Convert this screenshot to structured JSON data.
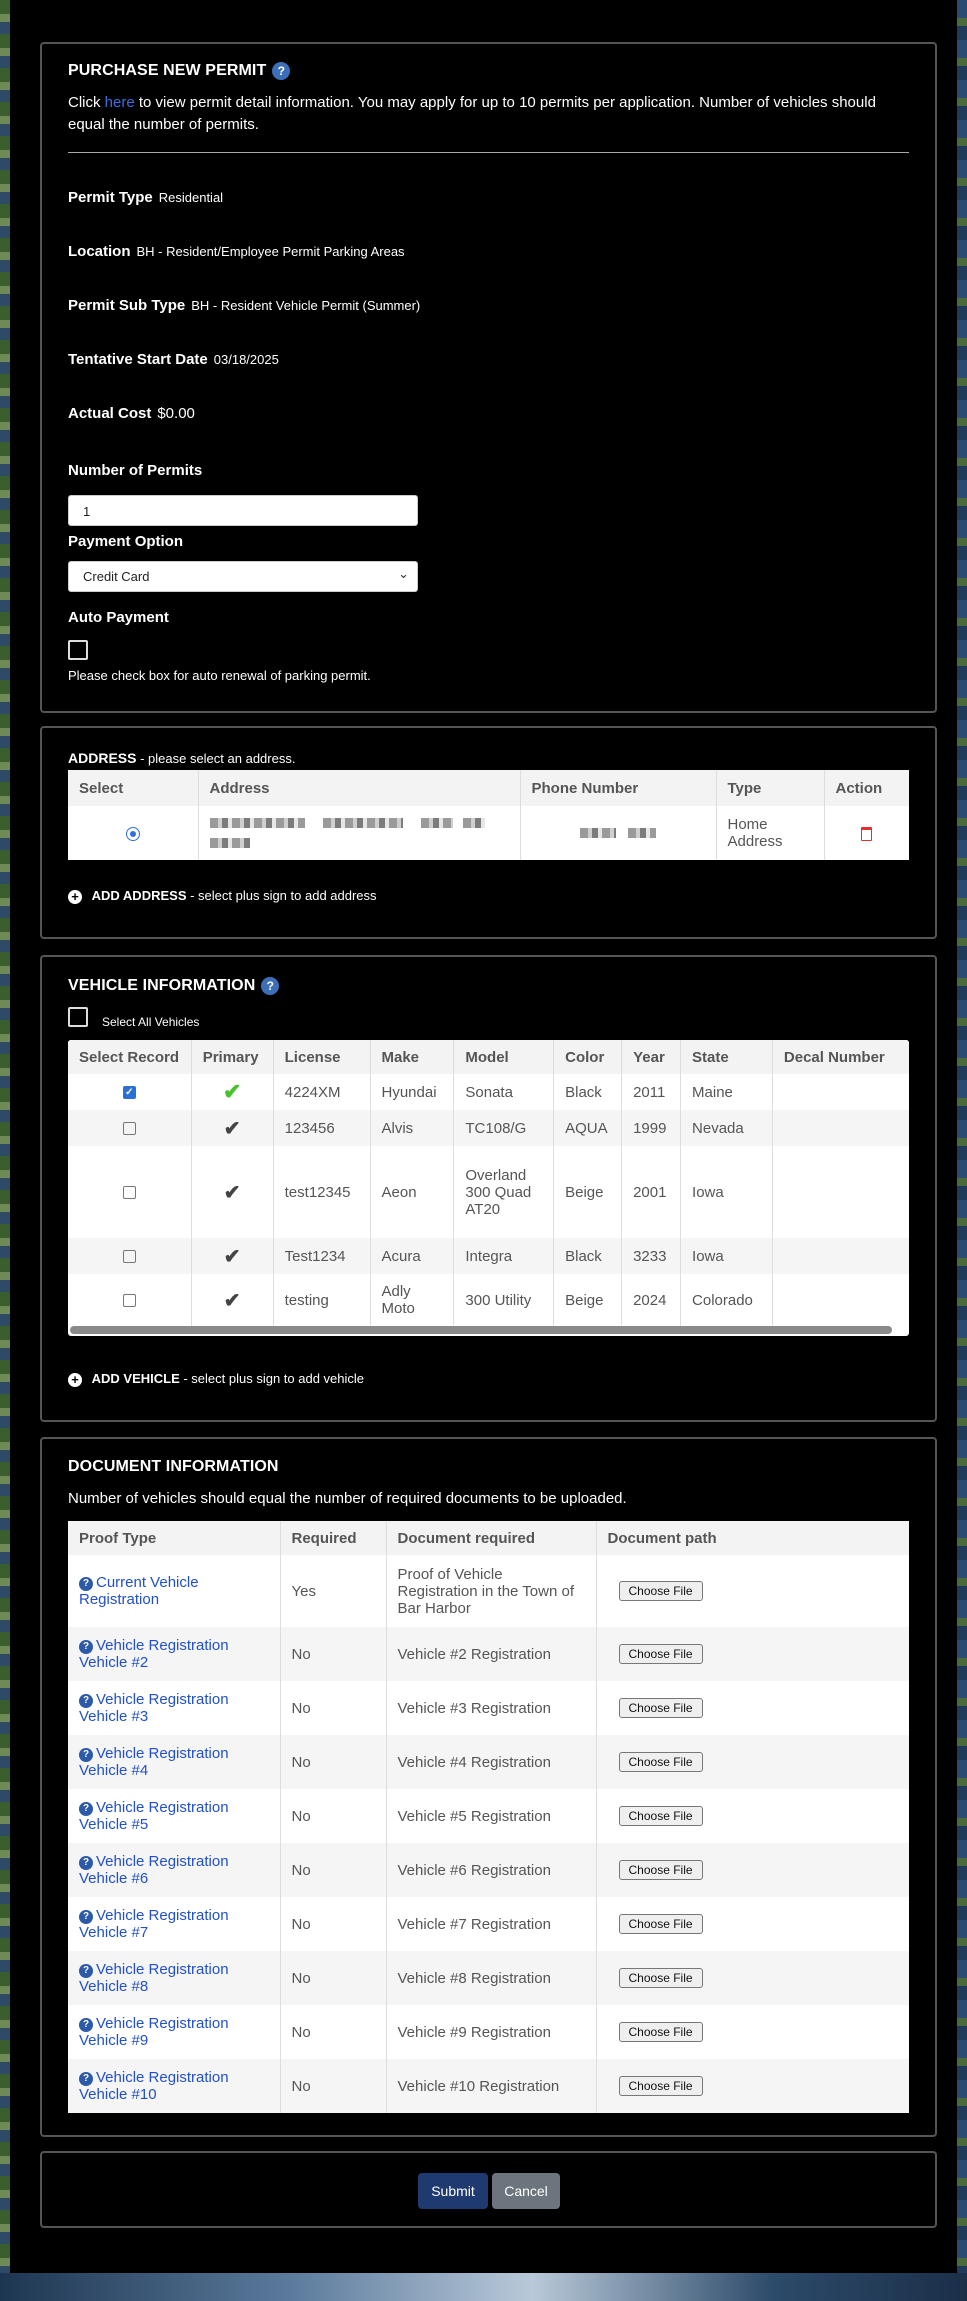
{
  "purchase": {
    "title": "PURCHASE NEW PERMIT",
    "help": "?",
    "intro_pre": "Click ",
    "intro_link": "here",
    "intro_post": " to view permit detail information. You may apply for up to 10 permits per application. Number of vehicles should equal the number of permits.",
    "fields": [
      {
        "label": "Permit Type",
        "value": "Residential"
      },
      {
        "label": "Location",
        "value": "BH - Resident/Employee Permit Parking Areas"
      },
      {
        "label": "Permit Sub Type",
        "value": "BH - Resident Vehicle Permit (Summer)"
      },
      {
        "label": "Tentative Start Date",
        "value": "03/18/2025"
      },
      {
        "label": "Actual Cost",
        "value": "$0.00"
      }
    ],
    "num_permits_label": "Number of Permits",
    "num_permits_value": "1",
    "payment_label": "Payment Option",
    "payment_value": "Credit Card",
    "auto_label": "Auto Payment",
    "auto_note": "Please check box for auto renewal of parking permit."
  },
  "address": {
    "title": "ADDRESS",
    "subtitle": " - please select an address.",
    "headers": [
      "Select",
      "Address",
      "Phone Number",
      "Type",
      "Action"
    ],
    "row_type": "Home Address",
    "add_label": "ADD ADDRESS",
    "add_note": " - select plus sign to add address"
  },
  "vehicle": {
    "title": "VEHICLE INFORMATION",
    "select_all": "Select All Vehicles",
    "headers": [
      "Select Record",
      "Primary",
      "License",
      "Make",
      "Model",
      "Color",
      "Year",
      "State",
      "Decal Number"
    ],
    "rows": [
      {
        "checked": true,
        "primary": true,
        "license": "4224XM",
        "make": "Hyundai",
        "model": "Sonata",
        "color": "Black",
        "year": "2011",
        "state": "Maine",
        "decal": ""
      },
      {
        "checked": false,
        "primary": false,
        "license": "123456",
        "make": "Alvis",
        "model": "TC108/G",
        "color": "AQUA",
        "year": "1999",
        "state": "Nevada",
        "decal": ""
      },
      {
        "checked": false,
        "primary": false,
        "license": "test12345",
        "make": "Aeon",
        "model": "Overland 300 Quad AT20",
        "color": "Beige",
        "year": "2001",
        "state": "Iowa",
        "decal": ""
      },
      {
        "checked": false,
        "primary": false,
        "license": "Test1234",
        "make": "Acura",
        "model": "Integra",
        "color": "Black",
        "year": "3233",
        "state": "Iowa",
        "decal": ""
      },
      {
        "checked": false,
        "primary": false,
        "license": "testing",
        "make": "Adly Moto",
        "model": "300 Utility",
        "color": "Beige",
        "year": "2024",
        "state": "Colorado",
        "decal": ""
      }
    ],
    "add_label": "ADD VEHICLE",
    "add_note": " - select plus sign to add vehicle"
  },
  "documents": {
    "title": "DOCUMENT INFORMATION",
    "note": "Number of vehicles should equal the number of required documents to be uploaded.",
    "headers": [
      "Proof Type",
      "Required",
      "Document required",
      "Document path"
    ],
    "file_button": "Choose File",
    "rows": [
      {
        "proof": "Current Vehicle Registration",
        "required": "Yes",
        "doc": "Proof of Vehicle Registration in the Town of Bar Harbor"
      },
      {
        "proof": "Vehicle Registration Vehicle #2",
        "required": "No",
        "doc": "Vehicle #2 Registration"
      },
      {
        "proof": "Vehicle Registration Vehicle #3",
        "required": "No",
        "doc": "Vehicle #3 Registration"
      },
      {
        "proof": "Vehicle Registration Vehicle #4",
        "required": "No",
        "doc": "Vehicle #4 Registration"
      },
      {
        "proof": "Vehicle Registration Vehicle #5",
        "required": "No",
        "doc": "Vehicle #5 Registration"
      },
      {
        "proof": "Vehicle Registration Vehicle #6",
        "required": "No",
        "doc": "Vehicle #6 Registration"
      },
      {
        "proof": "Vehicle Registration Vehicle #7",
        "required": "No",
        "doc": "Vehicle #7 Registration"
      },
      {
        "proof": "Vehicle Registration Vehicle #8",
        "required": "No",
        "doc": "Vehicle #8 Registration"
      },
      {
        "proof": "Vehicle Registration Vehicle #9",
        "required": "No",
        "doc": "Vehicle #9 Registration"
      },
      {
        "proof": "Vehicle Registration Vehicle #10",
        "required": "No",
        "doc": "Vehicle #10 Registration"
      }
    ]
  },
  "actions": {
    "submit": "Submit",
    "cancel": "Cancel"
  },
  "colors": {
    "submit": "#1f3a6e",
    "cancel": "#6c757d",
    "link": "#2150c8",
    "delete": "#e0312f"
  }
}
